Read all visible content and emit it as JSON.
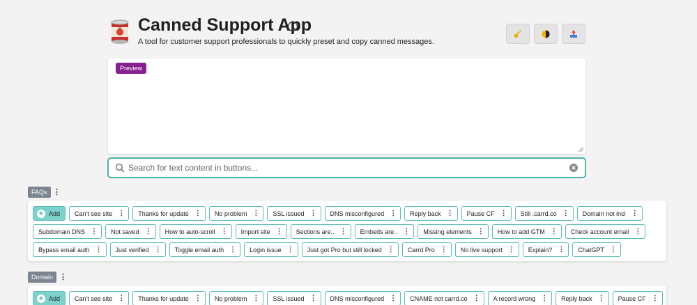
{
  "app": {
    "title": "Canned Support App",
    "subtitle": "A tool for customer support professionals to quickly preset and copy canned messages."
  },
  "toolbar": {
    "buttons": [
      {
        "icon": "key-icon"
      },
      {
        "icon": "theme-toggle-icon"
      },
      {
        "icon": "import-export-icon"
      }
    ]
  },
  "preview": {
    "badge": "Preview"
  },
  "search": {
    "placeholder": "Search for text content in buttons..."
  },
  "categories": [
    {
      "name": "FAQs",
      "add_label": "Add",
      "rows": [
        [
          "Can't see site",
          "Thanks for update",
          "No problem",
          "SSL issued",
          "DNS misconfigured",
          "Reply back",
          "Pause CF",
          "Still .carrd.co",
          "Domain not incl"
        ],
        [
          "Subdomain DNS",
          "Not saved",
          "How to auto-scroll",
          "Import site",
          "Sections are..",
          "Embeds are..",
          "Missing elements",
          "How to add GTM",
          "Check account email"
        ],
        [
          "Bypass email auth",
          "Just verified",
          "Toggle email auth",
          "Login issue",
          "Just got Pro but still locked",
          "Carrd Pro",
          "No live support",
          "Explain?",
          "ChatGPT"
        ]
      ]
    },
    {
      "name": "Domain",
      "add_label": "Add",
      "rows": [
        [
          "Can't see site",
          "Thanks for update",
          "No problem",
          "SSL issued",
          "DNS misconfigured",
          "CNAME not carrd.co",
          "A record wrong",
          "Reply back",
          "Pause CF"
        ]
      ]
    }
  ]
}
